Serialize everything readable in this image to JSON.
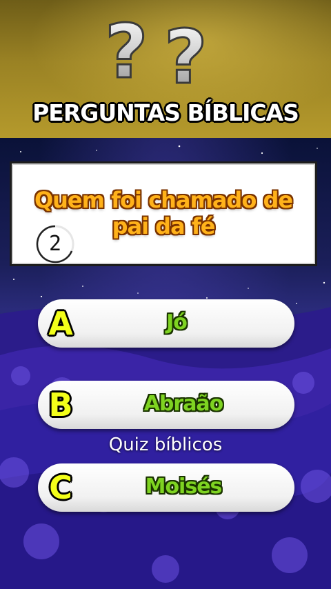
{
  "header": {
    "title": "PERGUNTAS BÍBLICAS",
    "decoration_icon": "question-marks-icon"
  },
  "question": {
    "lines": [
      "Quem foi chamado de",
      "pai da fé"
    ]
  },
  "timer": {
    "value": "2",
    "icon": "countdown-ring-icon"
  },
  "answers": [
    {
      "letter": "A",
      "text": "Jó"
    },
    {
      "letter": "B",
      "text": "Abraão"
    },
    {
      "letter": "C",
      "text": "Moisés"
    }
  ],
  "watermark": "Quiz bíblicos",
  "colors": {
    "header_gold": "#b59a2c",
    "question_text": "#ffb21a",
    "answer_text": "#7ed321",
    "letter_yellow": "#f3ff1a",
    "background_purple": "#2a1a7a"
  }
}
